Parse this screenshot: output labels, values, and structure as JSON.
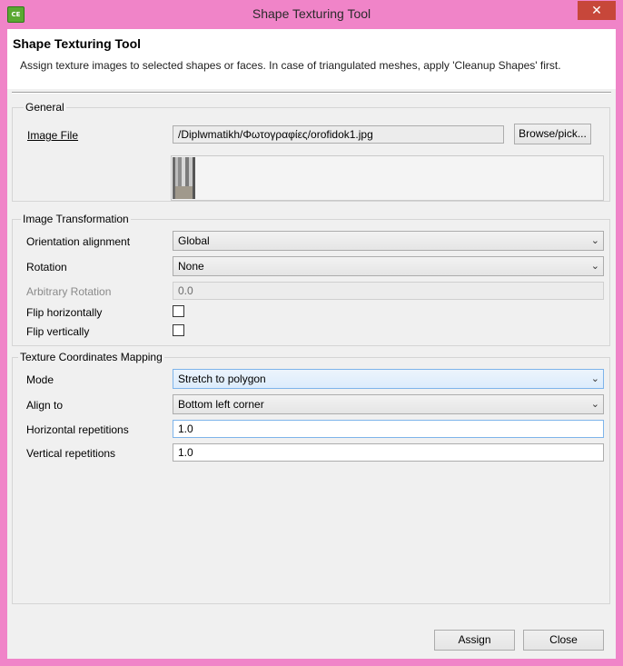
{
  "window": {
    "title": "Shape Texturing Tool",
    "app_icon": "CE",
    "close_glyph": "✕"
  },
  "header": {
    "title": "Shape Texturing Tool",
    "description": "Assign texture images to selected shapes or faces. In case of triangulated meshes, apply 'Cleanup Shapes' first."
  },
  "general": {
    "group_label": "General",
    "image_file_label": "Image File",
    "image_file_value": "/Diplwmatikh/Φωτογραφίες/orofidok1.jpg",
    "browse_label": "Browse/pick..."
  },
  "image_transformation": {
    "group_label": "Image Transformation",
    "orientation_label": "Orientation alignment",
    "orientation_value": "Global",
    "rotation_label": "Rotation",
    "rotation_value": "None",
    "arbitrary_label": "Arbitrary Rotation",
    "arbitrary_value": "0.0",
    "flip_h_label": "Flip horizontally",
    "flip_h_checked": false,
    "flip_v_label": "Flip vertically",
    "flip_v_checked": false
  },
  "texture_mapping": {
    "group_label": "Texture Coordinates Mapping",
    "mode_label": "Mode",
    "mode_value": "Stretch to polygon",
    "align_label": "Align to",
    "align_value": "Bottom left corner",
    "hrep_label": "Horizontal repetitions",
    "hrep_value": "1.0",
    "vrep_label": "Vertical repetitions",
    "vrep_value": "1.0"
  },
  "footer": {
    "assign_label": "Assign",
    "close_label": "Close"
  },
  "icons": {
    "dropdown": "⌄"
  }
}
